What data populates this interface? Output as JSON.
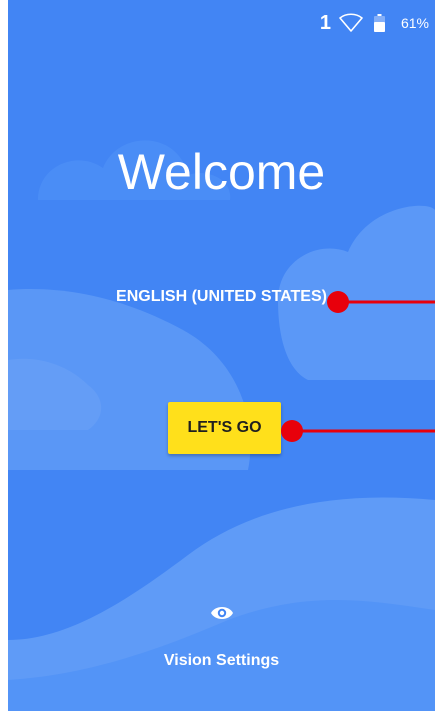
{
  "status_bar": {
    "notification_count": "1",
    "battery_percent": "61%",
    "wifi_icon": "wifi-icon",
    "battery_icon": "battery-icon"
  },
  "welcome": {
    "title": "Welcome",
    "language": "ENGLISH (UNITED STATES)",
    "start_button": "LET'S GO",
    "vision_settings": "Vision Settings",
    "vision_icon": "eye-icon"
  },
  "colors": {
    "background": "#4285f4",
    "button": "#ffe01b",
    "marker": "#e8000b"
  }
}
